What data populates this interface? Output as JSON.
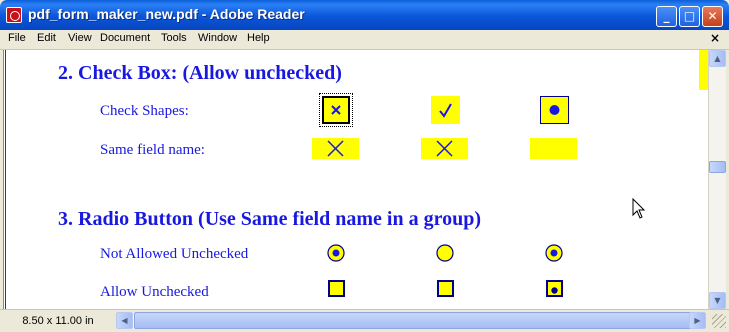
{
  "window": {
    "title": "pdf_form_maker_new.pdf - Adobe Reader",
    "app_icon": "adobe-reader-icon",
    "controls": {
      "minimize": "_",
      "maximize": "□",
      "close": "✕"
    }
  },
  "menu": {
    "items": [
      "File",
      "Edit",
      "View",
      "Document",
      "Tools",
      "Window",
      "Help"
    ],
    "doc_close": "×"
  },
  "document": {
    "section2": {
      "heading": "2. Check Box: (Allow unchecked)",
      "rows": [
        {
          "label": "Check Shapes:",
          "marks": [
            "✕",
            "✓",
            "●"
          ]
        },
        {
          "label": "Same field name:",
          "marks": [
            "✕",
            "✕",
            ""
          ]
        }
      ]
    },
    "section3": {
      "heading": "3. Radio Button (Use Same field name in a group)",
      "rows": [
        {
          "label": "Not Allowed Unchecked",
          "states": [
            "checked",
            "unchecked",
            "checked"
          ]
        },
        {
          "label": "Allow Unchecked",
          "states": [
            "unchecked",
            "unchecked",
            "checked"
          ]
        }
      ]
    }
  },
  "status": {
    "page_size": "8.50 x 11.00 in"
  },
  "colors": {
    "text_blue": "#1818e0",
    "field_yellow": "#ffff00",
    "field_border": "#00008b"
  }
}
